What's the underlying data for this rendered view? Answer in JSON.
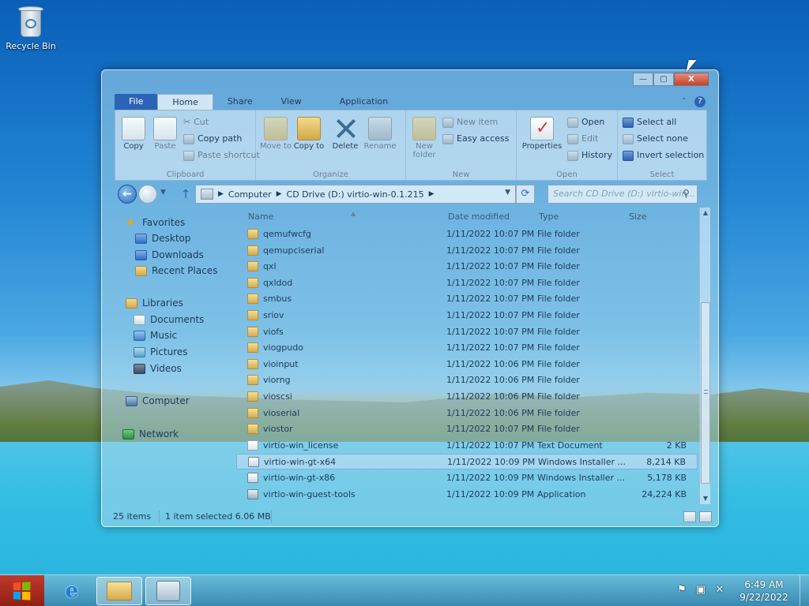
{
  "desktop": {
    "recycle_bin_label": "Recycle Bin"
  },
  "window": {
    "controls": {
      "minimize": "—",
      "maximize": "▢",
      "close": "X"
    },
    "ribbon_tabs": [
      "File",
      "Home",
      "Share",
      "View",
      "Application"
    ],
    "ribbon": {
      "clipboard": {
        "label": "Clipboard",
        "copy": "Copy",
        "paste": "Paste",
        "cut": "Cut",
        "copy_path": "Copy path",
        "paste_shortcut": "Paste shortcut"
      },
      "organize": {
        "label": "Organize",
        "move_to": "Move to",
        "copy_to": "Copy to",
        "delete": "Delete",
        "rename": "Rename"
      },
      "new": {
        "label": "New",
        "new_folder": "New folder",
        "new_item": "New item",
        "easy_access": "Easy access"
      },
      "open": {
        "label": "Open",
        "properties": "Properties",
        "open": "Open",
        "edit": "Edit",
        "history": "History"
      },
      "select": {
        "label": "Select",
        "select_all": "Select all",
        "select_none": "Select none",
        "invert_selection": "Invert selection"
      }
    },
    "address": {
      "segments": [
        "Computer",
        "CD Drive (D:) virtio-win-0.1.215"
      ],
      "search_placeholder": "Search CD Drive (D:) virtio-win..."
    },
    "nav_pane": {
      "favorites": "Favorites",
      "desktop": "Desktop",
      "downloads": "Downloads",
      "recent_places": "Recent Places",
      "libraries": "Libraries",
      "documents": "Documents",
      "music": "Music",
      "pictures": "Pictures",
      "videos": "Videos",
      "computer": "Computer",
      "network": "Network"
    },
    "columns": {
      "name": "Name",
      "date": "Date modified",
      "type": "Type",
      "size": "Size"
    },
    "files": [
      {
        "name": "qemufwcfg",
        "date": "1/11/2022 10:07 PM",
        "type": "File folder",
        "size": "",
        "kind": "folder"
      },
      {
        "name": "qemupciserial",
        "date": "1/11/2022 10:07 PM",
        "type": "File folder",
        "size": "",
        "kind": "folder"
      },
      {
        "name": "qxl",
        "date": "1/11/2022 10:07 PM",
        "type": "File folder",
        "size": "",
        "kind": "folder"
      },
      {
        "name": "qxldod",
        "date": "1/11/2022 10:07 PM",
        "type": "File folder",
        "size": "",
        "kind": "folder"
      },
      {
        "name": "smbus",
        "date": "1/11/2022 10:07 PM",
        "type": "File folder",
        "size": "",
        "kind": "folder"
      },
      {
        "name": "sriov",
        "date": "1/11/2022 10:07 PM",
        "type": "File folder",
        "size": "",
        "kind": "folder"
      },
      {
        "name": "viofs",
        "date": "1/11/2022 10:07 PM",
        "type": "File folder",
        "size": "",
        "kind": "folder"
      },
      {
        "name": "viogpudo",
        "date": "1/11/2022 10:07 PM",
        "type": "File folder",
        "size": "",
        "kind": "folder"
      },
      {
        "name": "vioinput",
        "date": "1/11/2022 10:06 PM",
        "type": "File folder",
        "size": "",
        "kind": "folder"
      },
      {
        "name": "viorng",
        "date": "1/11/2022 10:06 PM",
        "type": "File folder",
        "size": "",
        "kind": "folder"
      },
      {
        "name": "vioscsi",
        "date": "1/11/2022 10:06 PM",
        "type": "File folder",
        "size": "",
        "kind": "folder"
      },
      {
        "name": "vioserial",
        "date": "1/11/2022 10:06 PM",
        "type": "File folder",
        "size": "",
        "kind": "folder"
      },
      {
        "name": "viostor",
        "date": "1/11/2022 10:07 PM",
        "type": "File folder",
        "size": "",
        "kind": "folder"
      },
      {
        "name": "virtio-win_license",
        "date": "1/11/2022 10:07 PM",
        "type": "Text Document",
        "size": "2 KB",
        "kind": "txt"
      },
      {
        "name": "virtio-win-gt-x64",
        "date": "1/11/2022 10:09 PM",
        "type": "Windows Installer ...",
        "size": "8,214 KB",
        "kind": "msi",
        "selected": true
      },
      {
        "name": "virtio-win-gt-x86",
        "date": "1/11/2022 10:09 PM",
        "type": "Windows Installer ...",
        "size": "5,178 KB",
        "kind": "msi"
      },
      {
        "name": "virtio-win-guest-tools",
        "date": "1/11/2022 10:09 PM",
        "type": "Application",
        "size": "24,224 KB",
        "kind": "app"
      }
    ],
    "status": {
      "item_count": "25 items",
      "selection": "1 item selected  6.06 MB"
    }
  },
  "taskbar": {
    "time": "6:49 AM",
    "date": "9/22/2022",
    "icons": [
      "start-icon",
      "internet-explorer-icon",
      "file-explorer-icon",
      "server-manager-icon"
    ],
    "tray_icons": [
      "flag-icon",
      "network-icon",
      "speaker-muted-icon"
    ]
  }
}
